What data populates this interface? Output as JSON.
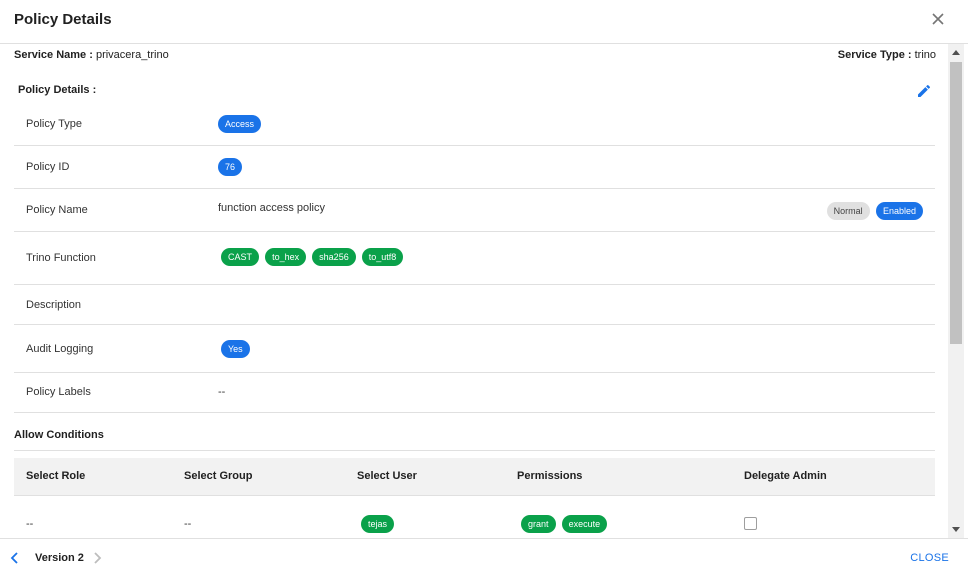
{
  "header": {
    "title": "Policy Details",
    "close_icon": "close-icon"
  },
  "service": {
    "name_label": "Service Name :",
    "name_value": "privacera_trino",
    "type_label": "Service Type :",
    "type_value": "trino"
  },
  "policy_section": {
    "label": "Policy Details :",
    "edit_icon": "pencil-icon"
  },
  "details": {
    "policy_type": {
      "label": "Policy Type",
      "value": "Access"
    },
    "policy_id": {
      "label": "Policy ID",
      "value": "76"
    },
    "policy_name": {
      "label": "Policy Name",
      "value": "function access policy",
      "badges": [
        "Normal",
        "Enabled"
      ]
    },
    "trino_function": {
      "label": "Trino Function",
      "values": [
        "CAST",
        "to_hex",
        "sha256",
        "to_utf8"
      ]
    },
    "description": {
      "label": "Description",
      "value": ""
    },
    "audit_logging": {
      "label": "Audit Logging",
      "value": "Yes"
    },
    "policy_labels": {
      "label": "Policy Labels",
      "value": "--"
    }
  },
  "allow_conditions": {
    "label": "Allow Conditions",
    "columns": [
      "Select Role",
      "Select Group",
      "Select User",
      "Permissions",
      "Delegate Admin"
    ],
    "rows": [
      {
        "role": "--",
        "group": "--",
        "users": [
          "tejas"
        ],
        "permissions": [
          "grant",
          "execute"
        ],
        "delegate_admin": false
      }
    ]
  },
  "footer": {
    "version": "Version 2",
    "close_label": "CLOSE"
  },
  "colors": {
    "accent": "#1a73e8",
    "green": "#0aa14a",
    "grey_chip": "#e0e0e0"
  }
}
